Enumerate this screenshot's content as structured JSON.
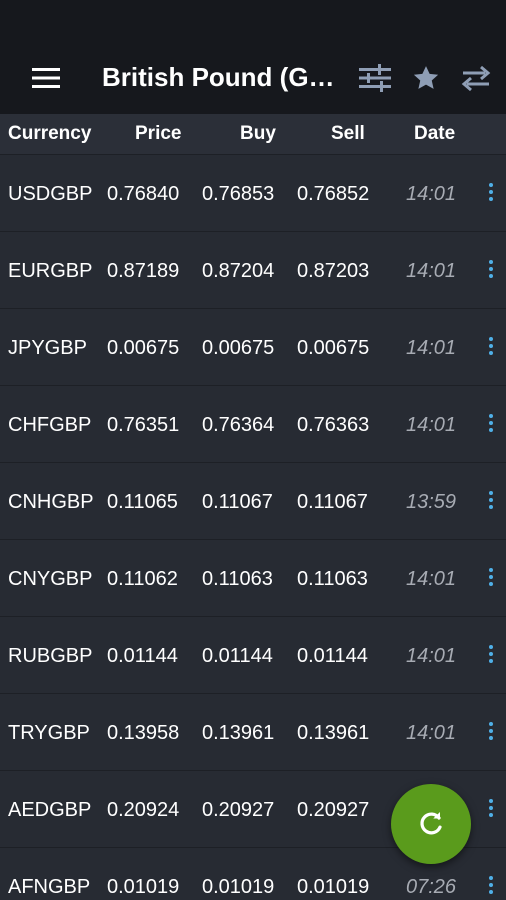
{
  "toolbar": {
    "title": "British Pound (GBP)",
    "icons": [
      "menu-icon",
      "sliders-icon",
      "star-icon",
      "swap-icon"
    ],
    "accent_color": "#4fb0e8"
  },
  "table": {
    "columns": [
      "Currency",
      "Price",
      "Buy",
      "Sell",
      "Date"
    ],
    "rows": [
      {
        "currency": "USDGBP",
        "price": "0.76840",
        "buy": "0.76853",
        "sell": "0.76852",
        "date": "14:01"
      },
      {
        "currency": "EURGBP",
        "price": "0.87189",
        "buy": "0.87204",
        "sell": "0.87203",
        "date": "14:01"
      },
      {
        "currency": "JPYGBP",
        "price": "0.00675",
        "buy": "0.00675",
        "sell": "0.00675",
        "date": "14:01"
      },
      {
        "currency": "CHFGBP",
        "price": "0.76351",
        "buy": "0.76364",
        "sell": "0.76363",
        "date": "14:01"
      },
      {
        "currency": "CNHGBP",
        "price": "0.11065",
        "buy": "0.11067",
        "sell": "0.11067",
        "date": "13:59"
      },
      {
        "currency": "CNYGBP",
        "price": "0.11062",
        "buy": "0.11063",
        "sell": "0.11063",
        "date": "14:01"
      },
      {
        "currency": "RUBGBP",
        "price": "0.01144",
        "buy": "0.01144",
        "sell": "0.01144",
        "date": "14:01"
      },
      {
        "currency": "TRYGBP",
        "price": "0.13958",
        "buy": "0.13961",
        "sell": "0.13961",
        "date": "14:01"
      },
      {
        "currency": "AEDGBP",
        "price": "0.20924",
        "buy": "0.20927",
        "sell": "0.20927",
        "date": ""
      },
      {
        "currency": "AFNGBP",
        "price": "0.01019",
        "buy": "0.01019",
        "sell": "0.01019",
        "date": "07:26"
      }
    ]
  },
  "fab": {
    "icon": "refresh-icon",
    "color": "#5a9b1c"
  }
}
